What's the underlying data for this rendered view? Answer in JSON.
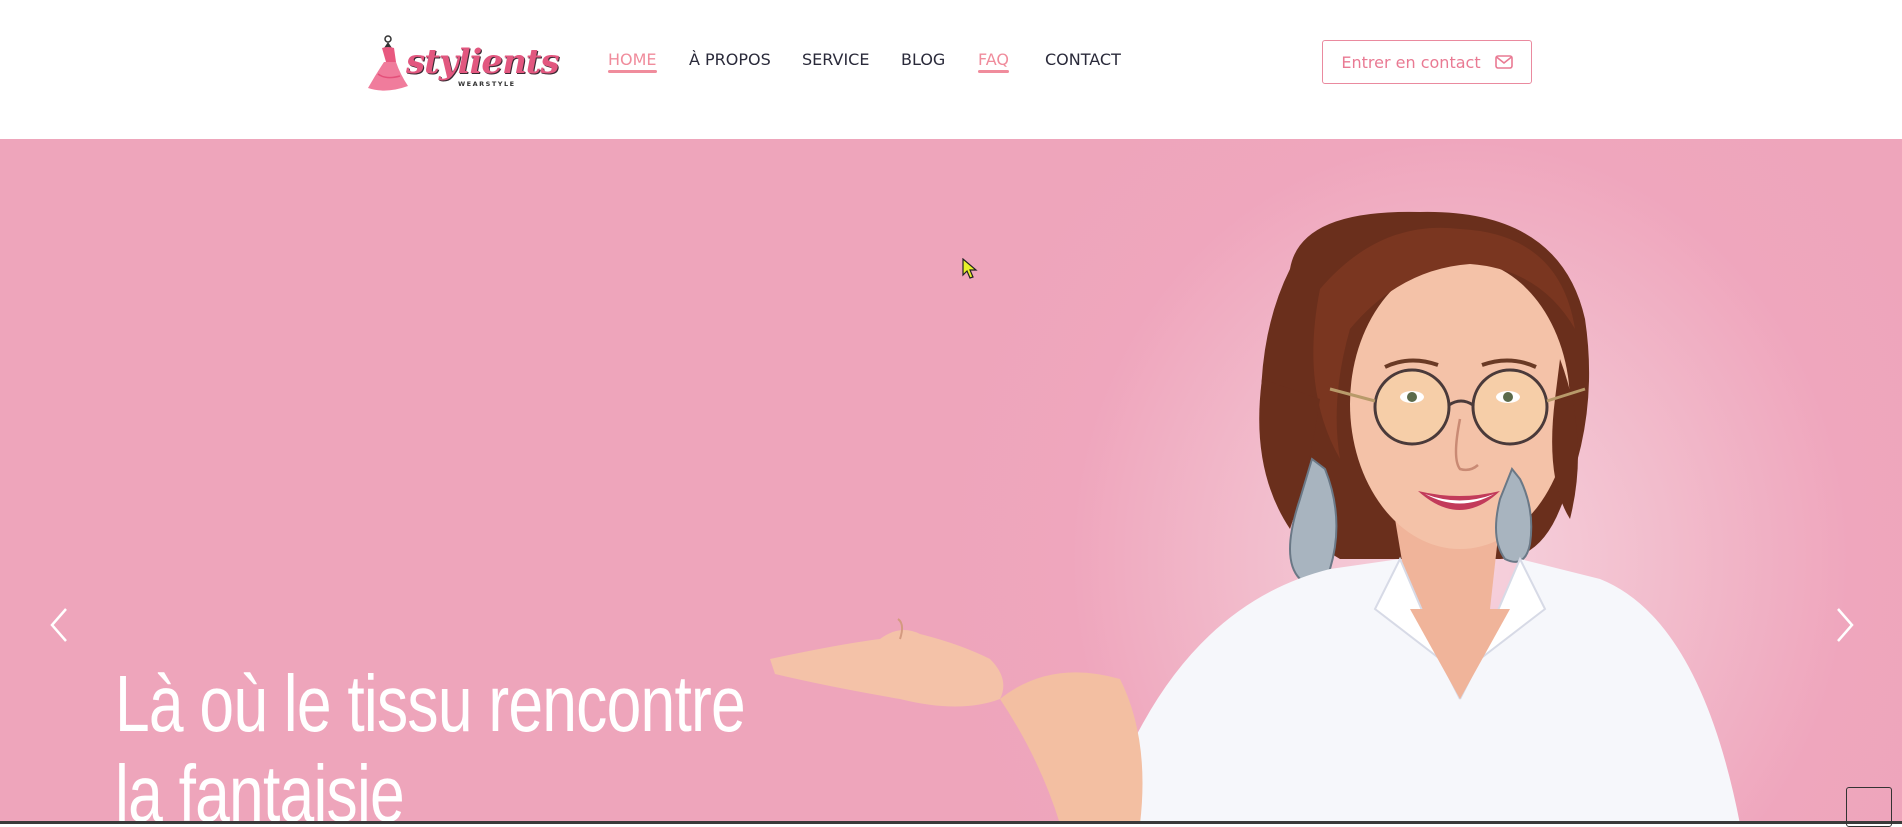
{
  "brand": {
    "name": "stylients",
    "tagline": "WEARSTYLE",
    "colors": {
      "accent": "#f08c9c",
      "hero_bg": "#eea5bb",
      "text_dark": "#2a2a3a"
    }
  },
  "nav": {
    "items": [
      {
        "label": "HOME",
        "active": true
      },
      {
        "label": "À PROPOS",
        "active": false
      },
      {
        "label": "SERVICE",
        "active": false
      },
      {
        "label": "BLOG",
        "active": false
      },
      {
        "label": "FAQ",
        "active": false
      },
      {
        "label": "CONTACT",
        "active": false
      }
    ]
  },
  "header": {
    "contact_button": {
      "label": "Entrer en contact",
      "icon": "envelope-icon"
    }
  },
  "hero": {
    "headline_line1": "Là où le tissu rencontre",
    "headline_line2": "la fantaisie",
    "prev_icon": "chevron-left-icon",
    "next_icon": "chevron-right-icon"
  }
}
